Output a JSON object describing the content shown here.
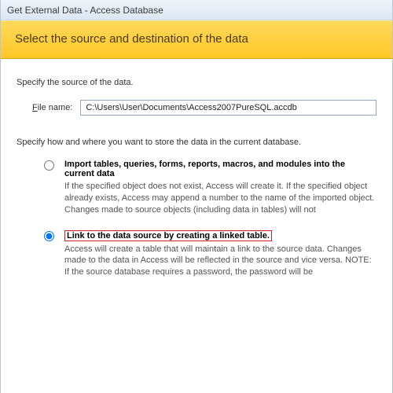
{
  "window": {
    "title": "Get External Data - Access Database"
  },
  "banner": {
    "heading": "Select the source and destination of the data"
  },
  "source": {
    "specify_label": "Specify the source of the data.",
    "file_label_pre": "F",
    "file_label_post": "ile name:",
    "file_value": "C:\\Users\\User\\Documents\\Access2007PureSQL.accdb"
  },
  "storage": {
    "specify_label": "Specify how and where you want to store the data in the current database."
  },
  "options": {
    "import": {
      "title": "Import tables, queries, forms, reports, macros, and modules into the current data",
      "desc": "If the specified object does not exist, Access will create it. If the specified object already exists, Access may append a number to the name of the imported object. Changes made to source objects (including data in tables) will not "
    },
    "link": {
      "title": "Link to the data source by creating a linked table.",
      "desc": "Access will create a table that will maintain a link to the source data. Changes made to the data in Access will be reflected in the source and vice versa. NOTE:  If the source database requires a password, the password will be"
    }
  }
}
